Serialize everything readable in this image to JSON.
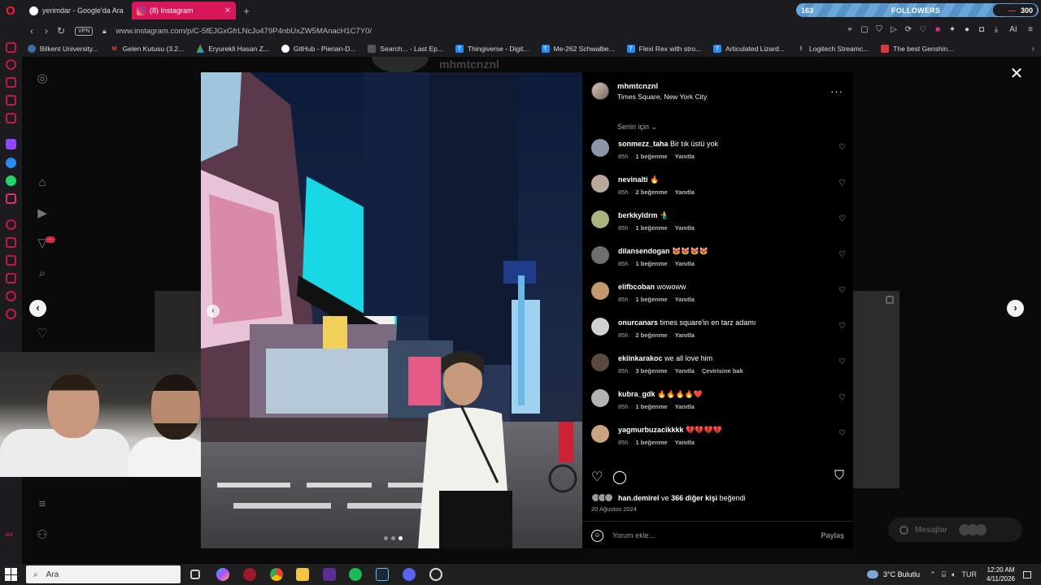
{
  "browser": {
    "tabs": [
      {
        "label": "yerimdar - Google'da Ara",
        "active": false
      },
      {
        "label": "(8) Instagram",
        "active": true
      }
    ],
    "url": "www.instagram.com/p/C-5fEJGxGfrLNcJu479P4nbUxZW5MAnacH1C7Y0/",
    "vpn_label": "VPN",
    "followers_widget": {
      "current": "163",
      "label": "FOLLOWERS",
      "goal": "300"
    },
    "bookmarks": [
      {
        "label": "Bilkent University...",
        "color": "#3a6ea5",
        "icon": ""
      },
      {
        "label": "Gelen Kutusu (3.2...",
        "color": "#ea4335",
        "icon": "M"
      },
      {
        "label": "Eryurekli Hasan Z...",
        "color": "#34a853",
        "icon": ""
      },
      {
        "label": "GitHub - Pierian-D...",
        "color": "#ffffff",
        "icon": ""
      },
      {
        "label": "Search... - Last Ep...",
        "color": "#444444",
        "icon": ""
      },
      {
        "label": "Thingiverse - Digit...",
        "color": "#248bfb",
        "icon": "T"
      },
      {
        "label": "Me-262 Schwalbe...",
        "color": "#248bfb",
        "icon": "T"
      },
      {
        "label": "Flexi Rex with stro...",
        "color": "#248bfb",
        "icon": "T"
      },
      {
        "label": "Articulated Lizard...",
        "color": "#248bfb",
        "icon": "T"
      },
      {
        "label": "Logitech Streamc...",
        "color": "#dddddd",
        "icon": "l"
      },
      {
        "label": "The best Genshin...",
        "color": "#e0353f",
        "icon": ""
      }
    ]
  },
  "background": {
    "username": "mhmtcnznl"
  },
  "post": {
    "username": "mhmtcnznl",
    "location": "Times Square, New York City",
    "sort_label": "Senin için",
    "likes_text": {
      "user": "han.demirel",
      "connector": "ve",
      "others": "366 diğer kişi",
      "suffix": "beğendi"
    },
    "date": "20 Ağustos 2024",
    "comment_placeholder": "Yorum ekle...",
    "share_label": "Paylaş"
  },
  "comments": [
    {
      "user": "sonmezz_taha",
      "text": "Bir tık üstü yok",
      "time": "85h",
      "likes": "1 beğenme",
      "reply": "Yanıtla",
      "extra": "",
      "avatar": "#8a97a8"
    },
    {
      "user": "nevinalti",
      "text": "🔥",
      "time": "85h",
      "likes": "2 beğenme",
      "reply": "Yanıtla",
      "extra": "",
      "avatar": "#b8a89a"
    },
    {
      "user": "berkkyldrm",
      "text": "🧜‍♂️",
      "time": "85h",
      "likes": "1 beğenme",
      "reply": "Yanıtla",
      "extra": "",
      "avatar": "#a8b37d"
    },
    {
      "user": "dilansendogan",
      "text": "😻😻😻😻",
      "time": "85h",
      "likes": "1 beğenme",
      "reply": "Yanıtla",
      "extra": "",
      "avatar": "#6f6f6f"
    },
    {
      "user": "elifbcoban",
      "text": "wowoww",
      "time": "85h",
      "likes": "1 beğenme",
      "reply": "Yanıtla",
      "extra": "",
      "avatar": "#c49a6c"
    },
    {
      "user": "onurcanars",
      "text": "times square'in en tarz adamı",
      "time": "85h",
      "likes": "2 beğenme",
      "reply": "Yanıtla",
      "extra": "",
      "avatar": "#d0d0d0"
    },
    {
      "user": "ekiinkarakoc",
      "text": "we all love him",
      "time": "85h",
      "likes": "3 beğenme",
      "reply": "Yanıtla",
      "extra": "Çevirisine bak",
      "avatar": "#5a4a3e"
    },
    {
      "user": "kubra_gdk",
      "text": "🔥🔥🔥🔥❤️",
      "time": "85h",
      "likes": "1 beğenme",
      "reply": "Yanıtla",
      "extra": "",
      "avatar": "#b3b3b3"
    },
    {
      "user": "yagmurbuzacikkkk",
      "text": "💔💔💔💔",
      "time": "85h",
      "likes": "1 beğenme",
      "reply": "Yanıtla",
      "extra": "",
      "avatar": "#c9a57f"
    }
  ],
  "taskbar": {
    "search_placeholder": "Ara",
    "weather": "3°C  Bulutlu",
    "language": "TUR",
    "time": "12:20 AM",
    "date": "4/11/2026"
  },
  "background_messages": "Mesajlar",
  "colors": {
    "accent": "#d9165a",
    "panel_bg": "#000000"
  }
}
